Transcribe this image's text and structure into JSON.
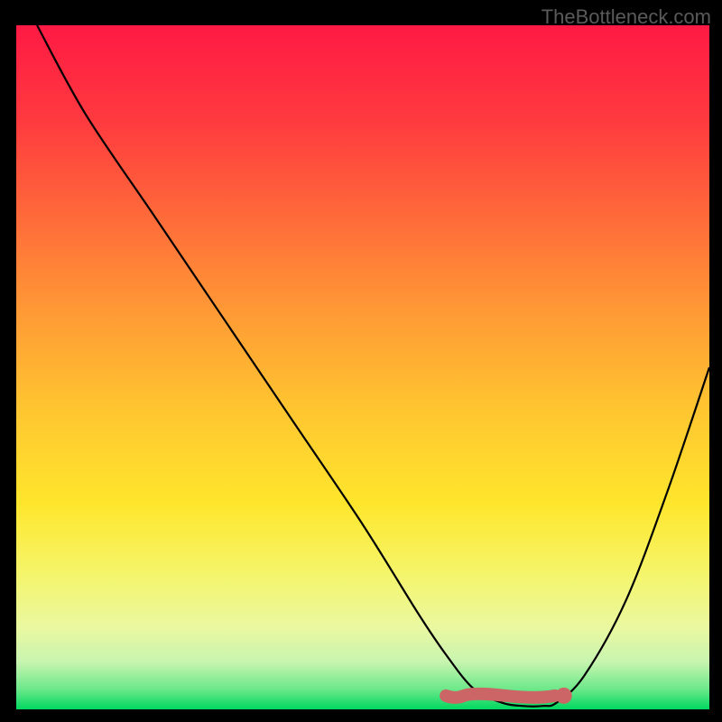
{
  "watermark": "TheBottleneck.com",
  "chart_data": {
    "type": "line",
    "title": "",
    "xlabel": "",
    "ylabel": "",
    "xlim": [
      0,
      100
    ],
    "ylim": [
      0,
      100
    ],
    "series": [
      {
        "name": "bottleneck-curve",
        "x": [
          3,
          10,
          20,
          30,
          40,
          50,
          58,
          62,
          66,
          70,
          73,
          76,
          78,
          82,
          88,
          94,
          100
        ],
        "values": [
          100,
          87,
          72,
          57,
          42,
          27,
          14,
          8,
          3,
          1,
          0.5,
          0.5,
          1,
          5,
          16,
          32,
          50
        ],
        "stroke": "#000000"
      }
    ],
    "highlight_band": {
      "name": "optimal-range",
      "x_start": 62,
      "x_end": 79,
      "y": 2,
      "color": "#cc6666"
    },
    "highlight_point": {
      "x": 79,
      "y": 2,
      "color": "#cc6666"
    },
    "background_gradient": {
      "stops": [
        {
          "offset": 0.0,
          "color": "#ff1a44"
        },
        {
          "offset": 0.14,
          "color": "#ff3a3f"
        },
        {
          "offset": 0.28,
          "color": "#ff6a3a"
        },
        {
          "offset": 0.42,
          "color": "#ff9a35"
        },
        {
          "offset": 0.56,
          "color": "#ffc530"
        },
        {
          "offset": 0.7,
          "color": "#ffe62c"
        },
        {
          "offset": 0.8,
          "color": "#f5f56a"
        },
        {
          "offset": 0.88,
          "color": "#eaf8a0"
        },
        {
          "offset": 0.93,
          "color": "#c8f5b0"
        },
        {
          "offset": 0.97,
          "color": "#6ee88a"
        },
        {
          "offset": 1.0,
          "color": "#00d860"
        }
      ]
    }
  }
}
